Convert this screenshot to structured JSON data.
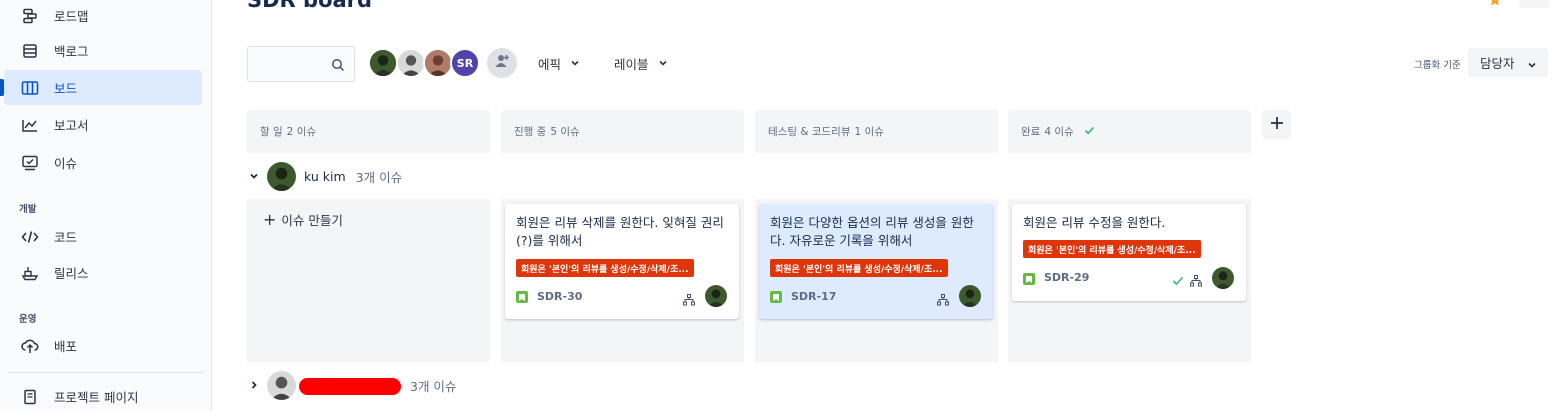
{
  "header": {
    "board_title": "SDR board"
  },
  "sidebar": {
    "items": [
      {
        "label": "로드맵",
        "icon": "roadmap-icon"
      },
      {
        "label": "백로그",
        "icon": "backlog-icon"
      },
      {
        "label": "보드",
        "icon": "board-icon",
        "active": true
      },
      {
        "label": "보고서",
        "icon": "reports-icon"
      },
      {
        "label": "이슈",
        "icon": "issues-icon"
      }
    ],
    "sections": {
      "dev": {
        "label": "개발",
        "items": [
          {
            "label": "코드",
            "icon": "code-icon"
          },
          {
            "label": "릴리스",
            "icon": "release-icon"
          }
        ]
      },
      "ops": {
        "label": "운영",
        "items": [
          {
            "label": "배포",
            "icon": "deploy-icon"
          }
        ]
      }
    },
    "project_page": {
      "label": "프로젝트 페이지",
      "icon": "page-icon"
    }
  },
  "toolbar": {
    "search": {
      "placeholder": "",
      "value": ""
    },
    "avatars": [
      "avatar-1",
      "avatar-2",
      "avatar-3",
      "SR"
    ],
    "epic_filter": "에픽",
    "label_filter": "레이블",
    "groupby_label": "그룹화 기준",
    "groupby_value": "담당자"
  },
  "columns": [
    {
      "name": "할 일",
      "count": "2 이슈"
    },
    {
      "name": "진행 중",
      "count": "5 이슈"
    },
    {
      "name": "테스팅 & 코드리뷰",
      "count": "1 이슈"
    },
    {
      "name": "완료",
      "count": "4 이슈",
      "done": true
    }
  ],
  "swimlanes": [
    {
      "name": "ku kim",
      "count": "3개 이슈",
      "expanded": true
    },
    {
      "name": "",
      "count": "3개 이슈",
      "expanded": false
    }
  ],
  "create_issue_label": "이슈 만들기",
  "cards": [
    {
      "summary": "회원은 리뷰 삭제를 원한다. 잊혀질 권리(?)를 위해서",
      "epic": "회원은 '본인'의 리뷰를 생성/수정/삭제/조...",
      "key": "SDR-30"
    },
    {
      "summary": "회원은 다양한 옵션의 리뷰 생성을 원한다. 자유로운 기록을 위해서",
      "epic": "회원은 '본인'의 리뷰를 생성/수정/삭제/조...",
      "key": "SDR-17"
    },
    {
      "summary": "회원은 리뷰 수정을 원한다.",
      "epic": "회원은 '본인'의 리뷰를 생성/수정/삭제/조...",
      "key": "SDR-29"
    }
  ],
  "colors": {
    "accent": "#0c52cc",
    "active_bg": "#deebff",
    "epic_tag": "#de350b",
    "story": "#65ba43",
    "done_check": "#36b37e"
  }
}
